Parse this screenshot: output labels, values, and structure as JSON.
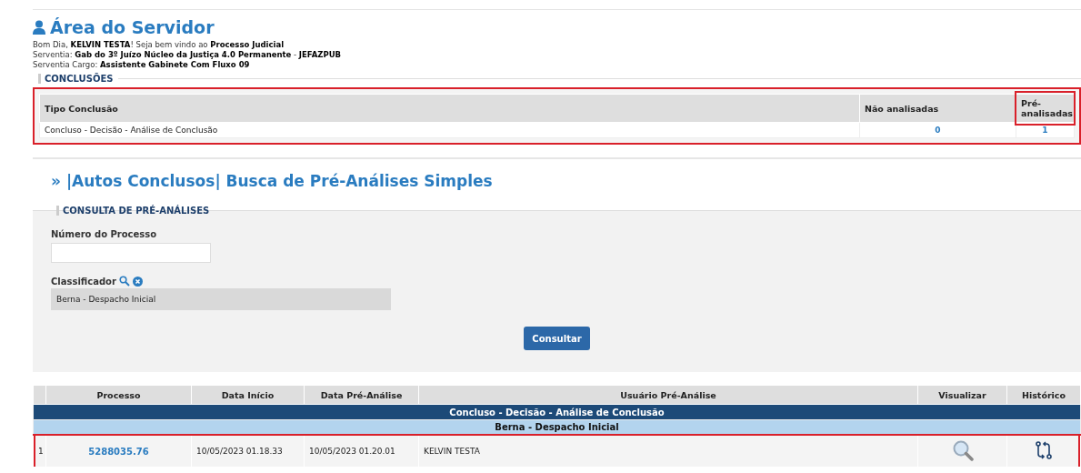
{
  "header": {
    "title": "Área do Servidor",
    "lines": [
      "Bom Dia, **KELVIN TESTA**! Seja bem vindo ao **Processo Judicial**",
      "Serventia: **Gab do 3º Juízo Núcleo da Justiça 4.0 Permanente** - **JEFAZPUB**",
      "Serventia Cargo: **Assistente Gabinete Com Fluxo 09**"
    ]
  },
  "conclusoes": {
    "legend": "CONCLUSÕES",
    "highlighted": true,
    "columns": [
      {
        "label": "Tipo Conclusão",
        "highlighted": false
      },
      {
        "label": "Não analisadas",
        "highlighted": false
      },
      {
        "label": "Pré-analisadas",
        "highlighted": true
      }
    ],
    "rows": [
      {
        "tipo": "Concluso - Decisão - Análise de Conclusão",
        "nao_analisadas": "0",
        "pre_analisadas": "1"
      }
    ]
  },
  "busca": {
    "title": "» |Autos Conclusos| Busca de Pré-Análises Simples",
    "legend": "CONSULTA DE PRÉ-ANÁLISES",
    "numero_label": "Número do Processo",
    "classificador_label": "Classificador",
    "classificador_value": "Berna - Despacho Inicial",
    "button": "Consultar"
  },
  "resultados": {
    "columns": [
      "Processo",
      "Data Início",
      "Data Pré-Análise",
      "Usuário Pré-Análise",
      "Visualizar",
      "Histórico"
    ],
    "rows": [
      {
        "kind": "group",
        "text": "Concluso - Decisão - Análise de Conclusão"
      },
      {
        "kind": "subgroup",
        "text": "Berna - Despacho Inicial"
      },
      {
        "kind": "record",
        "index": "1",
        "processo": "5288035.76",
        "data_inicio": "10/05/2023 01.18.33",
        "data_pre": "10/05/2023 01.20.01",
        "usuario": "KELVIN TESTA",
        "highlighted": true
      }
    ]
  }
}
